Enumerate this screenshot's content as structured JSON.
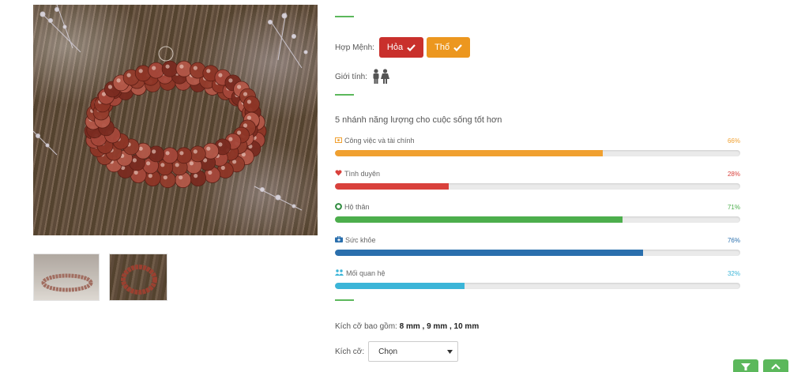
{
  "gallery": {
    "zoom_icon": "search-icon",
    "thumbnails": [
      "thumbnail-1",
      "thumbnail-2"
    ]
  },
  "menh": {
    "label": "Hợp Mệnh:",
    "elements": [
      {
        "label": "Hỏa",
        "color": "#c9302c",
        "icon": "check-icon"
      },
      {
        "label": "Thổ",
        "color": "#ec971f",
        "icon": "check-icon"
      }
    ]
  },
  "gender": {
    "label": "Giới tính:",
    "icon": "male-female-icon"
  },
  "energy": {
    "title": "5 nhánh năng lượng cho cuộc sống tốt hơn",
    "items": [
      {
        "label": "Công việc và tài chính",
        "percent": "66%",
        "value": 66,
        "color": "#f0a030",
        "icon": "money-icon"
      },
      {
        "label": "Tình duyên",
        "percent": "28%",
        "value": 28,
        "color": "#d9413c",
        "icon": "heart-icon"
      },
      {
        "label": "Hộ thân",
        "percent": "71%",
        "value": 71,
        "color": "#4cae4c",
        "icon": "lifebuoy-icon"
      },
      {
        "label": "Sức khỏe",
        "percent": "76%",
        "value": 76,
        "color": "#2a6fad",
        "icon": "medkit-icon"
      },
      {
        "label": "Mối quan hệ",
        "percent": "32%",
        "value": 32,
        "color": "#3bb5d8",
        "icon": "users-icon"
      }
    ]
  },
  "sizes": {
    "label": "Kích cỡ bao gồm:",
    "values": "8 mm , 9 mm , 10 mm",
    "select_label": "Kích cỡ:",
    "select_value": "Chọn"
  }
}
